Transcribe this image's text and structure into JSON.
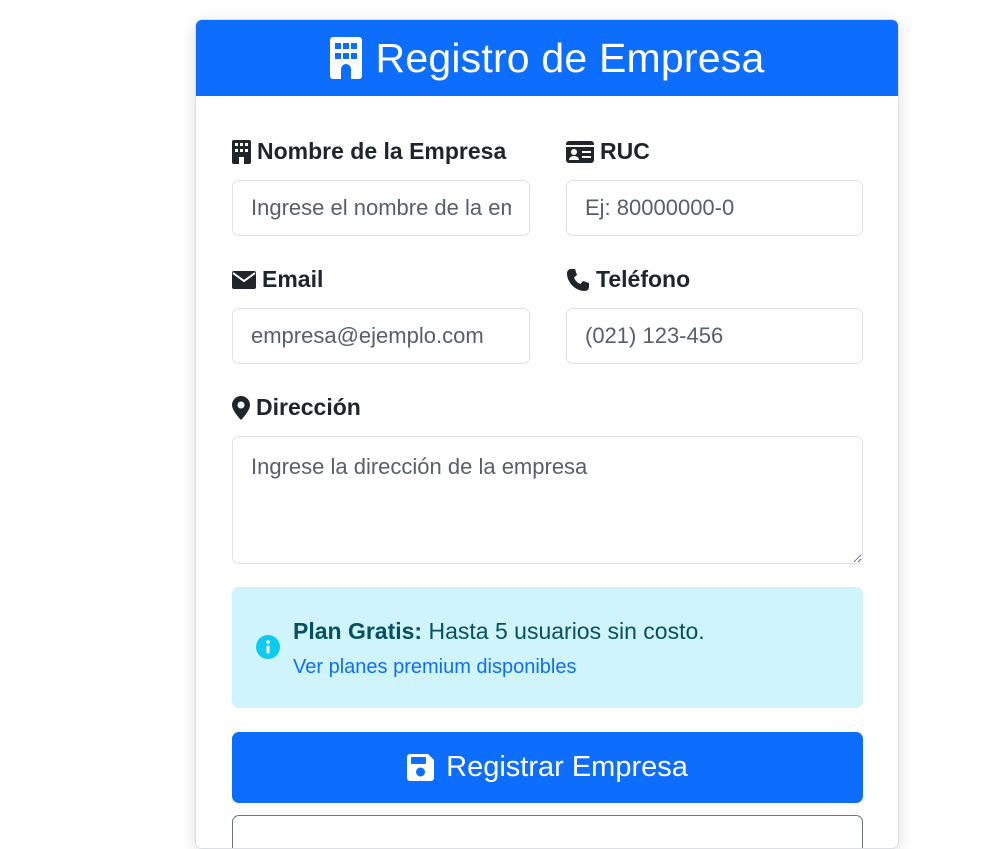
{
  "header": {
    "title": "Registro de Empresa",
    "icon": "building-icon"
  },
  "form": {
    "company_name": {
      "label": "Nombre de la Empresa",
      "placeholder": "Ingrese el nombre de la empresa",
      "icon": "building-icon"
    },
    "ruc": {
      "label": "RUC",
      "placeholder": "Ej: 80000000-0",
      "icon": "id-card-icon"
    },
    "email": {
      "label": "Email",
      "placeholder": "empresa@ejemplo.com",
      "icon": "envelope-icon"
    },
    "phone": {
      "label": "Teléfono",
      "placeholder": "(021) 123-456",
      "icon": "phone-icon"
    },
    "address": {
      "label": "Dirección",
      "placeholder": "Ingrese la dirección de la empresa",
      "icon": "map-marker-icon"
    }
  },
  "alert": {
    "title": "Plan Gratis:",
    "text": "Hasta 5 usuarios sin costo.",
    "link": "Ver planes premium disponibles",
    "icon": "info-circle-icon"
  },
  "submit": {
    "label": "Registrar Empresa",
    "icon": "save-icon"
  },
  "colors": {
    "primary": "#0d6efd",
    "info_bg": "#cff4fc",
    "info_text": "#055160",
    "info_icon": "#0dcaf0",
    "border": "#dee2e6"
  }
}
